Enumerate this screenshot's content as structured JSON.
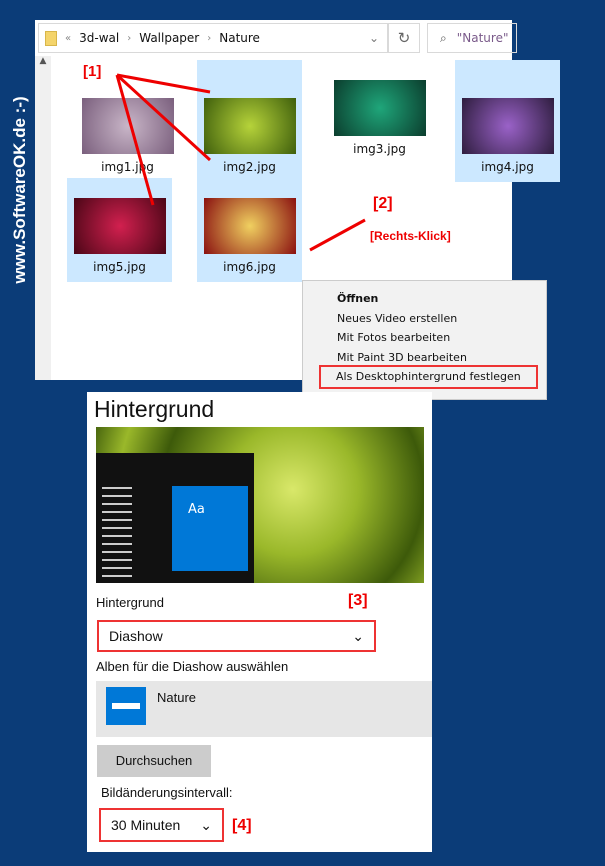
{
  "watermark_side": "www.SoftwareOK.de :-)",
  "explorer": {
    "breadcrumb": [
      "«",
      "3d-wal",
      "Wallpaper",
      "Nature"
    ],
    "search_placeholder": "\"Nature\"",
    "files": [
      {
        "name": "img1.jpg",
        "selected": false,
        "colors": [
          "#c9b6c8",
          "#7a5f7d"
        ]
      },
      {
        "name": "img2.jpg",
        "selected": true,
        "colors": [
          "#b6d33a",
          "#3f5f0c"
        ]
      },
      {
        "name": "img3.jpg",
        "selected": false,
        "colors": [
          "#1fa67a",
          "#0b3d2d"
        ]
      },
      {
        "name": "img4.jpg",
        "selected": true,
        "colors": [
          "#9a62c8",
          "#2e1d3e"
        ]
      },
      {
        "name": "img5.jpg",
        "selected": true,
        "colors": [
          "#d2204f",
          "#4a0616"
        ]
      },
      {
        "name": "img6.jpg",
        "selected": true,
        "colors": [
          "#f0d060",
          "#8a1010"
        ]
      }
    ]
  },
  "annotations": {
    "a1": "[1]",
    "a2": "[2]",
    "right_click": "[Rechts-Klick]",
    "a3": "[3]",
    "a4": "[4]"
  },
  "context_menu": [
    "Öffnen",
    "Neues Video erstellen",
    "Mit Fotos bearbeiten",
    "Mit Paint 3D bearbeiten",
    "Als Desktophintergrund festlegen"
  ],
  "settings": {
    "title": "Hintergrund",
    "preview_tile": "Aa",
    "background_label": "Hintergrund",
    "background_value": "Diashow",
    "albums_label": "Alben für die Diashow auswählen",
    "album_name": "Nature",
    "browse_button": "Durchsuchen",
    "interval_label": "Bildänderungsintervall:",
    "interval_value": "30 Minuten"
  },
  "colors": {
    "background": "#0b3c78",
    "accent": "#0078d7",
    "annotation": "#e00000",
    "selection": "#cce8ff"
  }
}
